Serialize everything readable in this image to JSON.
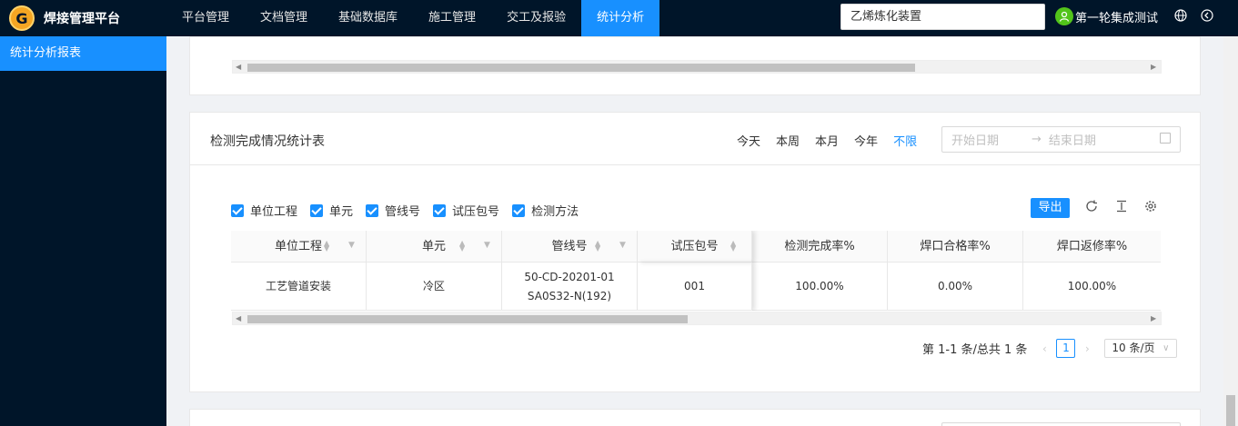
{
  "app": {
    "title": "焊接管理平台",
    "logo_letter": "G"
  },
  "nav": [
    {
      "label": "平台管理"
    },
    {
      "label": "文档管理"
    },
    {
      "label": "基础数据库"
    },
    {
      "label": "施工管理"
    },
    {
      "label": "交工及报验"
    },
    {
      "label": "统计分析"
    }
  ],
  "search": {
    "value": "乙烯炼化装置"
  },
  "user": {
    "name": "第一轮集成测试"
  },
  "icons": {
    "globe": "globe-icon",
    "logout": "logout-icon"
  },
  "sidebar": {
    "items": [
      {
        "label": "统计分析报表"
      }
    ]
  },
  "card": {
    "title": "检测完成情况统计表",
    "ranges": [
      "今天",
      "本周",
      "本月",
      "今年",
      "不限"
    ],
    "date_start_placeholder": "开始日期",
    "date_end_placeholder": "结束日期",
    "filters": [
      "单位工程",
      "单元",
      "管线号",
      "试压包号",
      "检测方法"
    ],
    "export_label": "导出",
    "table": {
      "columns": [
        "单位工程",
        "单元",
        "管线号",
        "试压包号",
        "检测完成率%",
        "焊口合格率%",
        "焊口返修率%"
      ],
      "rows": [
        {
          "c0": "工艺管道安装",
          "c1": "冷区",
          "c2": "50-CD-20201-01SA0S32-N(192)",
          "c3": "001",
          "c4": "100.00%",
          "c5": "0.00%",
          "c6": "100.00%"
        }
      ]
    },
    "pagination": {
      "summary": "第 1-1 条/总共 1 条",
      "current_page": "1",
      "page_size": "10 条/页"
    }
  },
  "colors": {
    "accent": "#1890ff",
    "nav_bg": "#001529"
  }
}
